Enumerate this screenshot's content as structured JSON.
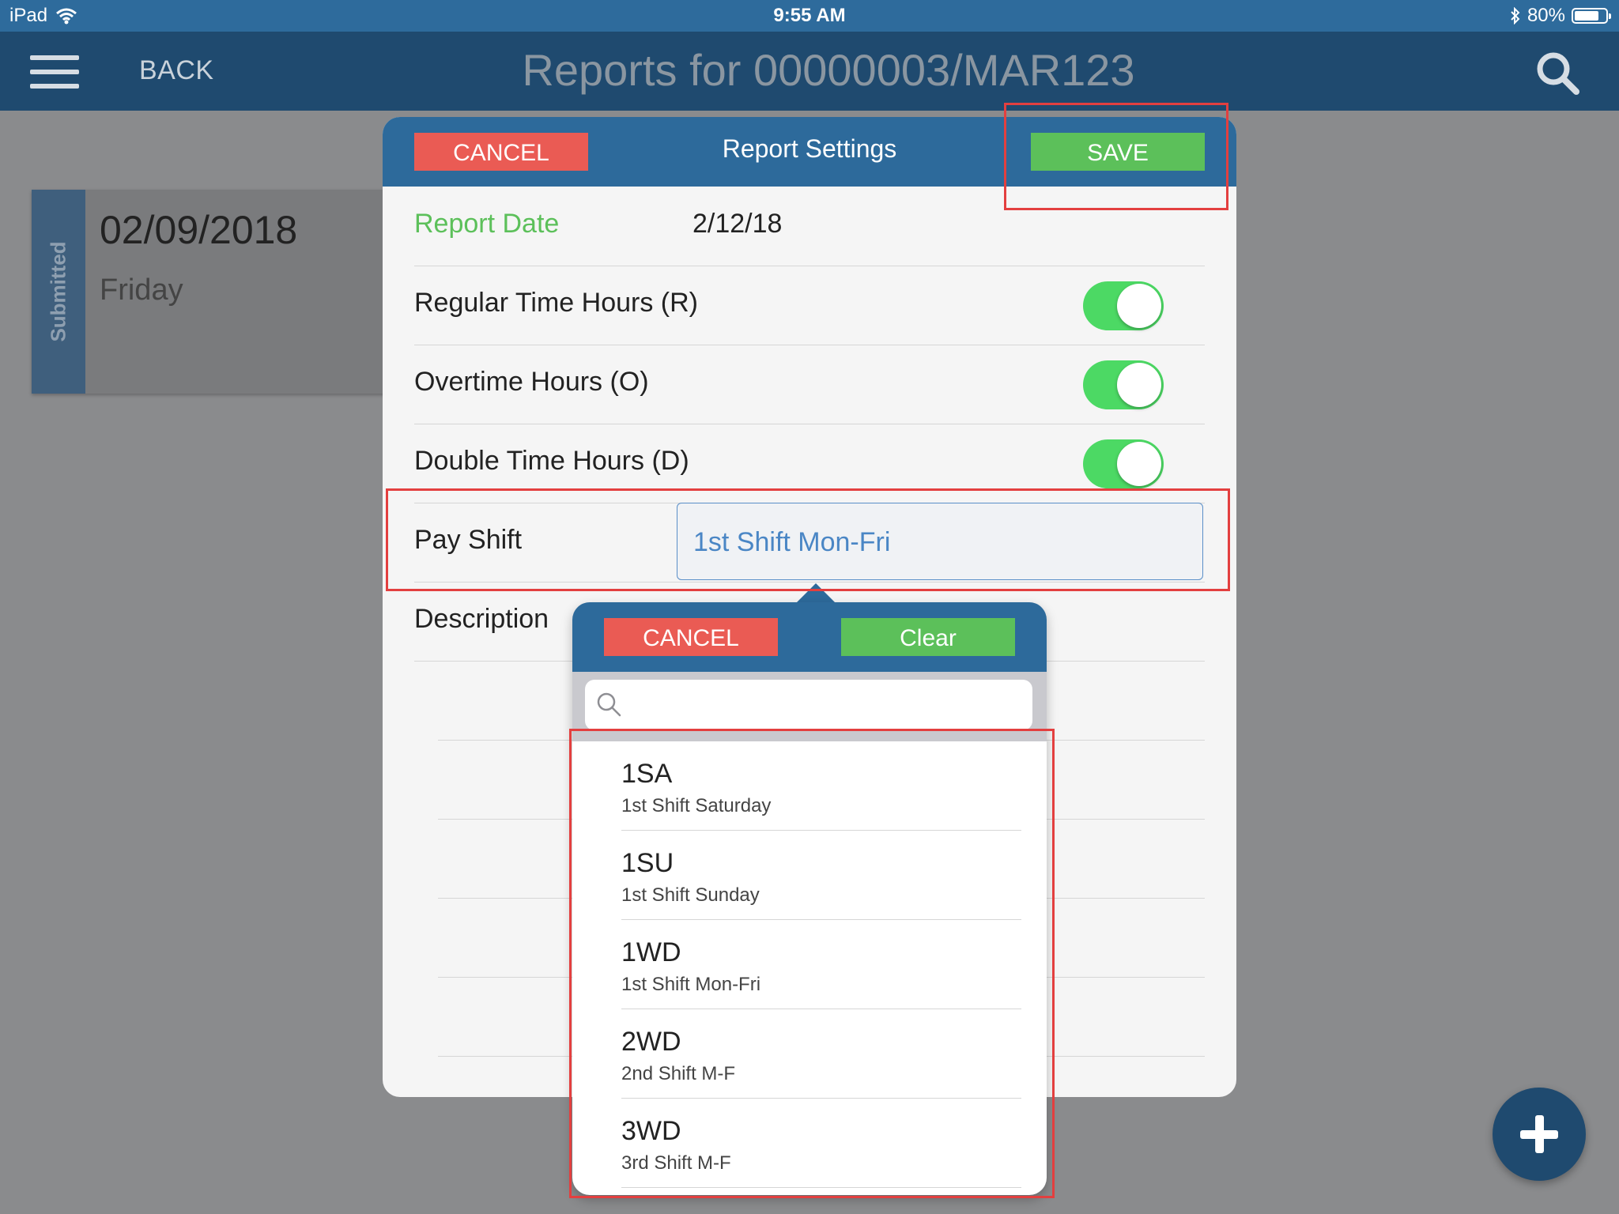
{
  "status_bar": {
    "device": "iPad",
    "time": "9:55 AM",
    "battery": "80%",
    "battery_level": 0.8,
    "icons": [
      "wifi-icon",
      "bluetooth-icon",
      "battery-icon"
    ]
  },
  "nav": {
    "back_label": "BACK",
    "title": "Reports for 00000003/MAR123",
    "icons": [
      "hamburger-menu-icon",
      "search-icon"
    ]
  },
  "report_card": {
    "status": "Submitted",
    "date": "02/09/2018",
    "day": "Friday"
  },
  "modal": {
    "title": "Report Settings",
    "cancel_label": "CANCEL",
    "save_label": "SAVE",
    "fields": {
      "report_date_label": "Report Date",
      "report_date_value": "2/12/18",
      "regular_label": "Regular Time Hours (R)",
      "regular_on": true,
      "overtime_label": "Overtime Hours (O)",
      "overtime_on": true,
      "double_label": "Double Time Hours (D)",
      "double_on": true,
      "pay_shift_label": "Pay Shift",
      "pay_shift_value": "1st Shift Mon-Fri",
      "description_label": "Description"
    }
  },
  "picker": {
    "cancel_label": "CANCEL",
    "clear_label": "Clear",
    "search_placeholder": "",
    "items": [
      {
        "code": "1SA",
        "desc": "1st Shift Saturday"
      },
      {
        "code": "1SU",
        "desc": "1st Shift Sunday"
      },
      {
        "code": "1WD",
        "desc": "1st Shift Mon-Fri"
      },
      {
        "code": "2WD",
        "desc": "2nd Shift M-F"
      },
      {
        "code": "3WD",
        "desc": "3rd Shift M-F"
      }
    ]
  },
  "colors": {
    "header_blue": "#2d6a9b",
    "nav_dark": "#1f4a6f",
    "cancel_red": "#ea5b54",
    "save_green": "#5cc05a",
    "toggle_green": "#4cd964",
    "highlight_red": "#e33f3f"
  }
}
